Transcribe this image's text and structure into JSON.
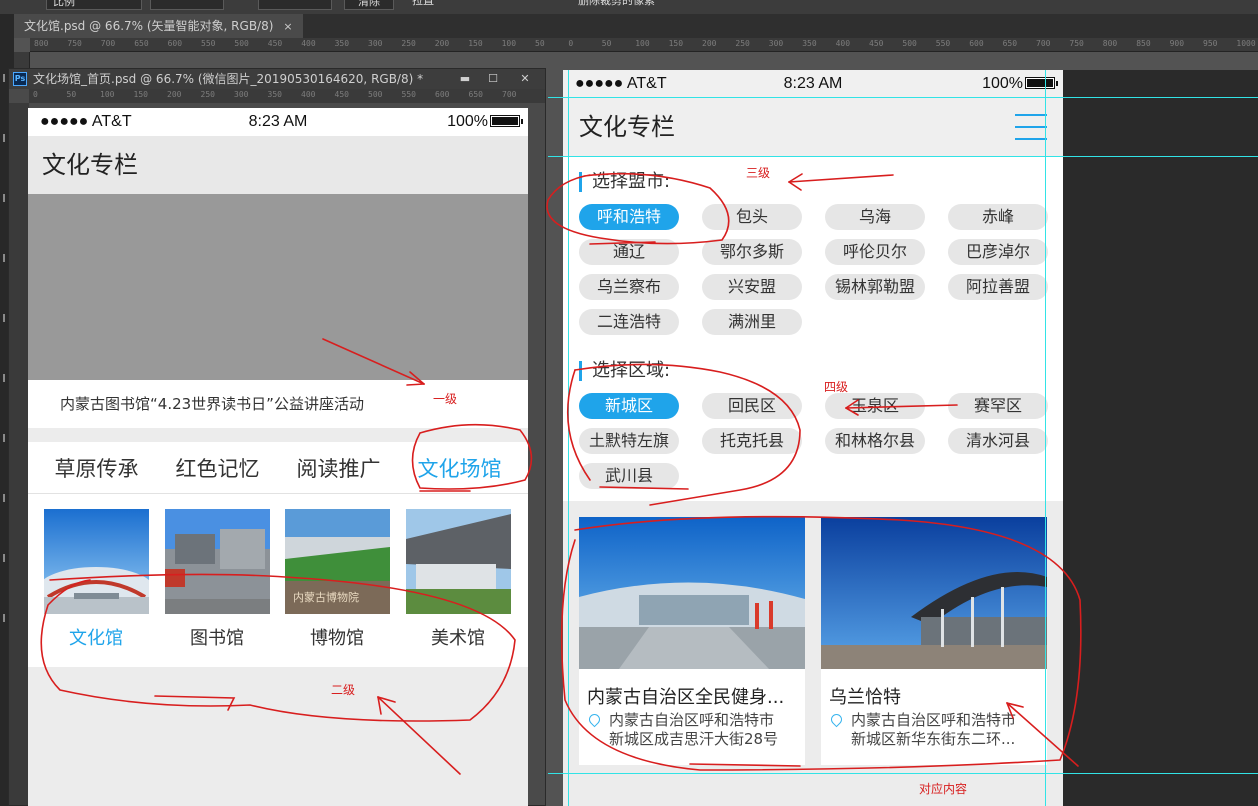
{
  "photoshop": {
    "options_bar": {
      "dropdown_value": "比例",
      "clear_label": "清除",
      "straighten_label": "拉直",
      "delete_checkbox_label": "删除裁剪的像素"
    },
    "main_tab": {
      "title": "文化馆.psd @ 66.7% (矢量智能对象, RGB/8)",
      "close": "×"
    },
    "float_window": {
      "title": "文化场馆_首页.psd @ 66.7% (微信图片_20190530164620, RGB/8) *",
      "logo": "Ps",
      "minimize": "▬",
      "maximize": "☐",
      "close": "✕"
    },
    "ruler_marks": [
      "800",
      "750",
      "700",
      "650",
      "600",
      "550",
      "500",
      "450",
      "400",
      "350",
      "300",
      "250",
      "200",
      "150",
      "100",
      "50",
      "0",
      "50",
      "100",
      "150",
      "200",
      "250",
      "300",
      "350",
      "400",
      "450",
      "500",
      "550",
      "600",
      "650",
      "700",
      "750",
      "800",
      "850",
      "900",
      "950",
      "1000"
    ],
    "float_ruler_marks": [
      "0",
      "50",
      "100",
      "150",
      "200",
      "250",
      "300",
      "350",
      "400",
      "450",
      "500",
      "550",
      "600",
      "650",
      "700"
    ]
  },
  "status": {
    "carrier": "●●●●● AT&T",
    "time": "8:23 AM",
    "battery": "100%"
  },
  "home": {
    "header_title": "文化专栏",
    "banner_caption": "内蒙古图书馆“4.23世界读书日”公益讲座活动",
    "tabs": [
      "草原传承",
      "红色记忆",
      "阅读推广",
      "文化场馆"
    ],
    "active_tab": "文化场馆",
    "venues": [
      "文化馆",
      "图书馆",
      "博物馆",
      "美术馆"
    ],
    "active_venue": "文化馆",
    "museum_sign": "内蒙古博物院"
  },
  "venue_page": {
    "header_title": "文化专栏",
    "city_section": {
      "title": "选择盟市:",
      "options": [
        "呼和浩特",
        "包头",
        "乌海",
        "赤峰",
        "通辽",
        "鄂尔多斯",
        "呼伦贝尔",
        "巴彦淖尔",
        "乌兰察布",
        "兴安盟",
        "锡林郭勒盟",
        "阿拉善盟",
        "二连浩特",
        "满洲里"
      ],
      "selected": "呼和浩特"
    },
    "district_section": {
      "title": "选择区域:",
      "options": [
        "新城区",
        "回民区",
        "玉泉区",
        "赛罕区",
        "土默特左旗",
        "托克托县",
        "和林格尔县",
        "清水河县",
        "武川县"
      ],
      "selected": "新城区"
    },
    "cards": [
      {
        "title": "内蒙古自治区全民健身...",
        "address_line1": "内蒙古自治区呼和浩特市",
        "address_line2": "新城区成吉思汗大街28号"
      },
      {
        "title": "乌兰恰特",
        "address_line1": "内蒙古自治区呼和浩特市",
        "address_line2": "新城区新华东街东二环..."
      }
    ]
  },
  "annotations": {
    "level1": "一级",
    "level2": "二级",
    "level3": "三级",
    "level4": "四级",
    "content": "对应内容"
  },
  "colors": {
    "accent": "#1fa4ea",
    "annotation": "#d81e1e",
    "guide": "#32e3e6",
    "ps_bg": "#535353"
  }
}
